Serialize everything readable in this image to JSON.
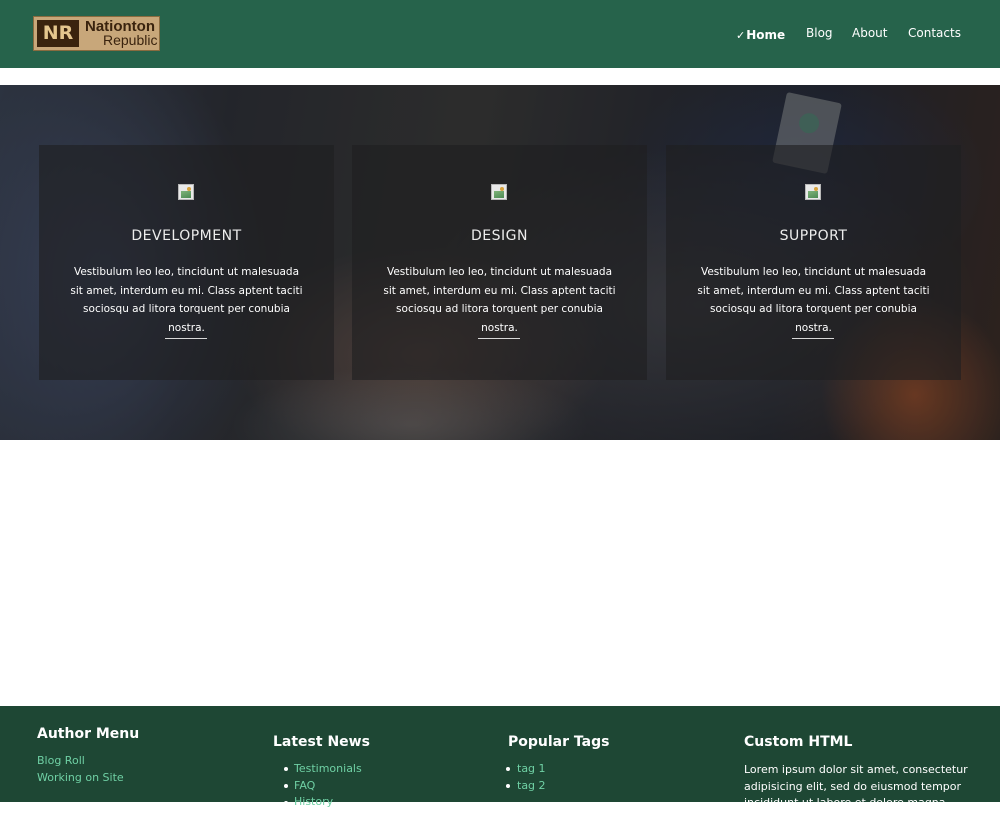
{
  "header": {
    "logo": {
      "mark": "NR",
      "line1": "Nationton",
      "line2": "Republic"
    },
    "nav": [
      {
        "label": "Home",
        "active": true
      },
      {
        "label": "Blog",
        "active": false
      },
      {
        "label": "About",
        "active": false
      },
      {
        "label": "Contacts",
        "active": false
      }
    ],
    "active_marker": "✓"
  },
  "hero": {
    "cards": [
      {
        "title": "DEVELOPMENT",
        "text": "Vestibulum leo leo, tincidunt ut malesuada sit amet, interdum eu mi. Class aptent taciti sociosqu ad litora torquent per conubia nostra."
      },
      {
        "title": "DESIGN",
        "text": "Vestibulum leo leo, tincidunt ut malesuada sit amet, interdum eu mi. Class aptent taciti sociosqu ad litora torquent per conubia nostra."
      },
      {
        "title": "SUPPORT",
        "text": "Vestibulum leo leo, tincidunt ut malesuada sit amet, interdum eu mi. Class aptent taciti sociosqu ad litora torquent per conubia nostra."
      }
    ]
  },
  "footer": {
    "author_menu": {
      "title": "Author Menu",
      "links": [
        "Blog Roll",
        "Working on Site"
      ]
    },
    "latest_news": {
      "title": "Latest News",
      "links": [
        "Testimonials",
        "FAQ",
        "History"
      ]
    },
    "popular_tags": {
      "title": "Popular Tags",
      "links": [
        "tag 1",
        "tag 2"
      ]
    },
    "custom_html": {
      "title": "Custom HTML",
      "text": "Lorem ipsum dolor sit amet, consectetur adipisicing elit, sed do eiusmod tempor incididunt ut labore et dolore magna aliqua."
    }
  },
  "colors": {
    "header_bg": "#26634b",
    "footer_bg": "#1e4734",
    "link": "#6fd0a4",
    "logo_bg": "#c8a77a",
    "logo_mark_bg": "#3a230e"
  },
  "icons": {
    "card_image": "broken-image-icon",
    "active_nav": "checkmark-icon",
    "list_bullet": "bullet-icon"
  }
}
